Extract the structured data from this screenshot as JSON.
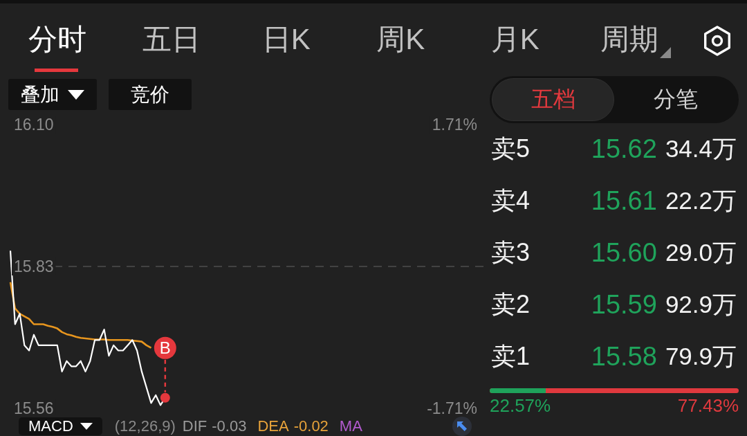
{
  "tabs": [
    {
      "label": "分时",
      "selected": true,
      "kind": "plain"
    },
    {
      "label": "五日",
      "selected": false,
      "kind": "plain"
    },
    {
      "label": "日K",
      "selected": false,
      "kind": "plain"
    },
    {
      "label": "周K",
      "selected": false,
      "kind": "plain"
    },
    {
      "label": "月K",
      "selected": false,
      "kind": "plain"
    },
    {
      "label": "周期",
      "selected": false,
      "kind": "menu"
    }
  ],
  "chart_tools": [
    {
      "label": "叠加",
      "kind": "dropdown"
    },
    {
      "label": "竞价",
      "kind": "plain"
    }
  ],
  "chart": {
    "chart_data": [
      {
        "type": "line",
        "ylim": [
          15.56,
          16.1
        ],
        "yticks": [
          {
            "value": 15.56,
            "label": "15.56"
          },
          {
            "value": 15.83,
            "label": "15.83"
          },
          {
            "value": 16.1,
            "label": "16.10"
          }
        ],
        "y2lim": [
          -1.71,
          1.71
        ],
        "y2ticks": [
          {
            "value": -1.71,
            "label": "-1.71%"
          },
          {
            "value": 1.71,
            "label": "1.71%"
          }
        ],
        "ref_lines": [
          {
            "axis": "y",
            "value": 15.83,
            "line_style": "dashed"
          }
        ],
        "series": [
          {
            "color": "#ffffff",
            "values": [
              15.86,
              15.72,
              15.74,
              15.68,
              15.67,
              15.7,
              15.68,
              15.68,
              15.68,
              15.68,
              15.68,
              15.63,
              15.65,
              15.64,
              15.64,
              15.65,
              15.63,
              15.65,
              15.69,
              15.69,
              15.71,
              15.66,
              15.68,
              15.67,
              15.67,
              15.68,
              15.69,
              15.67,
              15.63,
              15.6,
              15.57,
              15.585,
              15.566,
              15.58,
              null,
              null,
              null,
              null,
              null,
              null,
              null,
              null,
              null,
              null,
              null,
              null,
              null,
              null,
              null,
              null,
              null,
              null,
              null,
              null,
              null,
              null,
              null,
              null,
              null,
              null,
              null,
              null,
              null,
              null,
              null,
              null,
              null,
              null,
              null,
              null,
              null,
              null,
              null,
              null,
              null,
              null,
              null,
              null,
              null,
              null,
              null,
              null,
              null,
              null,
              null,
              null,
              null,
              null,
              null,
              null,
              null,
              null,
              null,
              null,
              null,
              null,
              null,
              null,
              null,
              null,
              null
            ]
          },
          {
            "color": "#e8961e",
            "values": [
              15.8,
              15.75,
              15.74,
              15.735,
              15.73,
              15.72,
              15.72,
              15.72,
              15.717,
              15.715,
              15.712,
              15.705,
              15.701,
              15.699,
              15.696,
              15.694,
              15.693,
              15.692,
              15.691,
              15.691,
              15.691,
              15.69,
              15.69,
              15.69,
              15.69,
              15.69,
              15.689,
              15.688,
              15.687,
              15.68,
              15.675,
              null,
              null,
              null,
              null,
              null,
              null,
              null,
              null,
              null,
              null,
              null,
              null,
              null,
              null,
              null,
              null,
              null,
              null,
              null,
              null,
              null,
              null,
              null,
              null,
              null,
              null,
              null,
              null,
              null,
              null,
              null,
              null,
              null,
              null,
              null,
              null,
              null,
              null,
              null,
              null,
              null,
              null,
              null,
              null,
              null,
              null,
              null,
              null,
              null,
              null,
              null,
              null,
              null,
              null,
              null,
              null,
              null,
              null,
              null,
              null,
              null,
              null,
              null,
              null,
              null,
              null,
              null,
              null,
              null,
              null,
              null
            ]
          }
        ],
        "annotations": [
          "B"
        ]
      }
    ]
  },
  "indicator": {
    "selector": "MACD",
    "params": "(12,26,9)",
    "items": [
      {
        "label": "DIF",
        "value": "-0.03",
        "color": "#9a9a9a"
      },
      {
        "label": "DEA",
        "value": "-0.02",
        "color": "#e8a33a"
      },
      {
        "label": "MA",
        "color": "#b35bd0"
      }
    ]
  },
  "order_book": {
    "tabs": [
      {
        "label": "五档",
        "selected": true
      },
      {
        "label": "分笔",
        "selected": false
      }
    ],
    "rows": [
      {
        "label": "卖5",
        "price": "15.62",
        "volume": "34.4万"
      },
      {
        "label": "卖4",
        "price": "15.61",
        "volume": "22.2万"
      },
      {
        "label": "卖3",
        "price": "15.60",
        "volume": "29.0万"
      },
      {
        "label": "卖2",
        "price": "15.59",
        "volume": "92.9万"
      },
      {
        "label": "卖1",
        "price": "15.58",
        "volume": "79.9万"
      }
    ],
    "ratio": {
      "level": 0.2257,
      "buy": "22.57%",
      "sell": "77.43%"
    }
  }
}
